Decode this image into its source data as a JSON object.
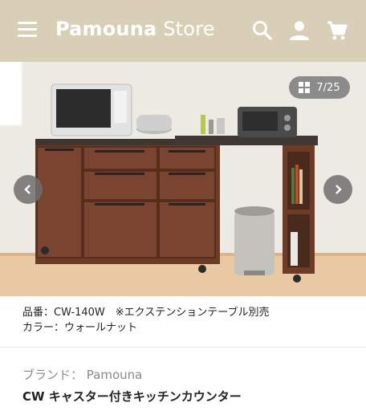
{
  "header": {
    "brand_bold": "Pamouna",
    "brand_light": "Store",
    "icons": [
      "menu-icon",
      "search-icon",
      "account-icon",
      "cart-icon"
    ],
    "background": "#d9cfb7"
  },
  "gallery": {
    "counter": "7/25",
    "counter_icon": "grid-icon",
    "prev_icon": "chevron-left-icon",
    "next_icon": "chevron-right-icon"
  },
  "caption": {
    "line1": "品番：CW-140W　※エクステンションテーブル別売",
    "line2": "カラー：ウォールナット"
  },
  "product": {
    "brand_line": "ブランド：  Pamouna",
    "title": "CW キャスター付きキッチンカウンター"
  }
}
